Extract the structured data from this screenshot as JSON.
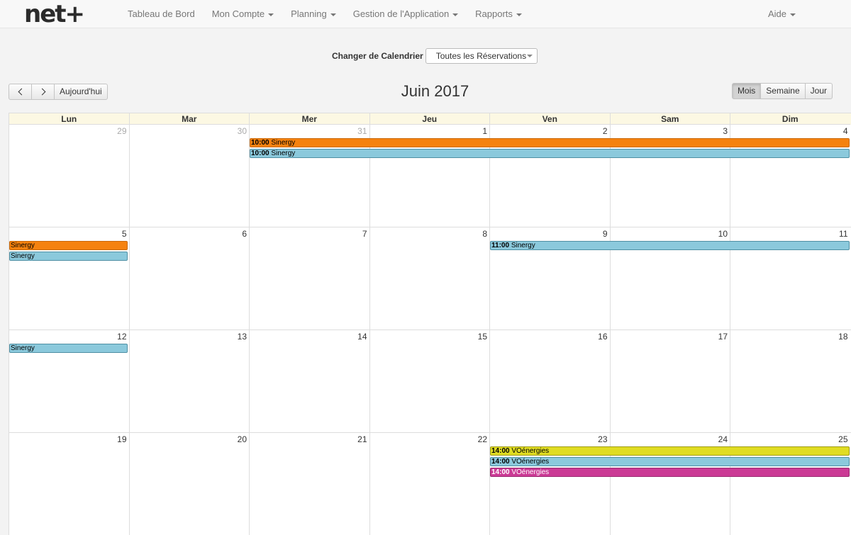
{
  "navbar": {
    "brand": "net+",
    "items": [
      {
        "label": "Tableau de Bord",
        "dropdown": false
      },
      {
        "label": "Mon Compte",
        "dropdown": true
      },
      {
        "label": "Planning",
        "dropdown": true
      },
      {
        "label": "Gestion de l'Application",
        "dropdown": true
      },
      {
        "label": "Rapports",
        "dropdown": true
      }
    ],
    "right": {
      "label": "Aide",
      "dropdown": true
    }
  },
  "switcher": {
    "label": "Changer de Calendrier",
    "selected": "Toutes les Réservations"
  },
  "toolbar": {
    "today": "Aujourd'hui",
    "title": "Juin 2017",
    "views": [
      {
        "label": "Mois",
        "active": true
      },
      {
        "label": "Semaine",
        "active": false
      },
      {
        "label": "Jour",
        "active": false
      }
    ]
  },
  "days": [
    "Lun",
    "Mar",
    "Mer",
    "Jeu",
    "Ven",
    "Sam",
    "Dim"
  ],
  "weeks": [
    {
      "dates": [
        {
          "n": "29",
          "other": true
        },
        {
          "n": "30",
          "other": true
        },
        {
          "n": "31",
          "other": true
        },
        {
          "n": "1"
        },
        {
          "n": "2"
        },
        {
          "n": "3"
        },
        {
          "n": "4"
        }
      ],
      "events": [
        {
          "time": "10:00",
          "title": "Sinergy",
          "color": "orange",
          "start": 2,
          "span": 5,
          "row": 0
        },
        {
          "time": "10:00",
          "title": "Sinergy",
          "color": "blue",
          "start": 2,
          "span": 5,
          "row": 1
        }
      ]
    },
    {
      "dates": [
        {
          "n": "5"
        },
        {
          "n": "6"
        },
        {
          "n": "7"
        },
        {
          "n": "8"
        },
        {
          "n": "9"
        },
        {
          "n": "10"
        },
        {
          "n": "11"
        }
      ],
      "events": [
        {
          "time": "",
          "title": "Sinergy",
          "color": "orange",
          "start": 0,
          "span": 1,
          "row": 0
        },
        {
          "time": "",
          "title": "Sinergy",
          "color": "blue",
          "start": 0,
          "span": 1,
          "row": 1
        },
        {
          "time": "11:00",
          "title": "Sinergy",
          "color": "blue",
          "start": 4,
          "span": 3,
          "row": 0
        }
      ]
    },
    {
      "dates": [
        {
          "n": "12"
        },
        {
          "n": "13"
        },
        {
          "n": "14"
        },
        {
          "n": "15"
        },
        {
          "n": "16"
        },
        {
          "n": "17"
        },
        {
          "n": "18"
        }
      ],
      "events": [
        {
          "time": "",
          "title": "Sinergy",
          "color": "blue",
          "start": 0,
          "span": 1,
          "row": 0
        }
      ]
    },
    {
      "dates": [
        {
          "n": "19"
        },
        {
          "n": "20"
        },
        {
          "n": "21"
        },
        {
          "n": "22"
        },
        {
          "n": "23"
        },
        {
          "n": "24"
        },
        {
          "n": "25"
        }
      ],
      "events": [
        {
          "time": "14:00",
          "title": "VOénergies",
          "color": "yellow",
          "start": 4,
          "span": 3,
          "row": 0
        },
        {
          "time": "14:00",
          "title": "VOénergies",
          "color": "blue",
          "start": 4,
          "span": 3,
          "row": 1
        },
        {
          "time": "14:00",
          "title": "VOénergies",
          "color": "magenta",
          "start": 4,
          "span": 3,
          "row": 2
        }
      ]
    }
  ]
}
